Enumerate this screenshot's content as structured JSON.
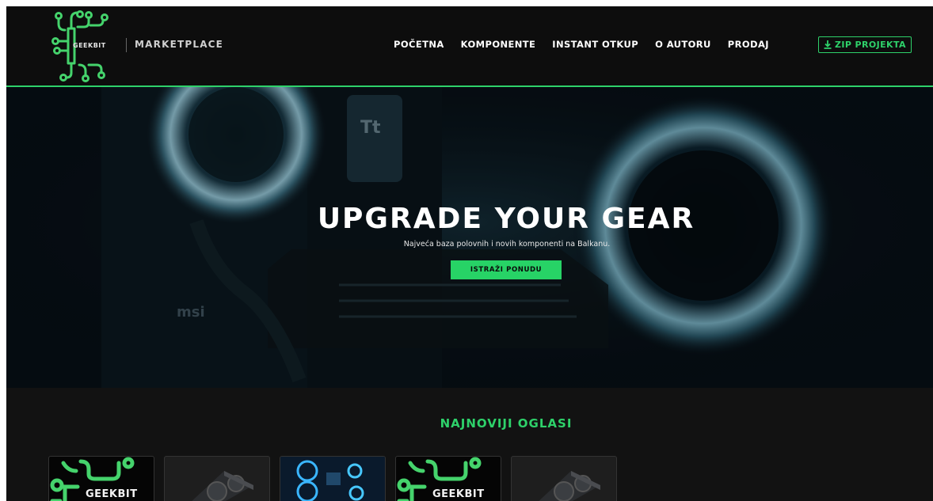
{
  "nav": {
    "brand": "GEEKBIT",
    "marketplace": "MARKETPLACE",
    "items": [
      {
        "label": "POČETNA"
      },
      {
        "label": "KOMPONENTE"
      },
      {
        "label": "INSTANT OTKUP"
      },
      {
        "label": "O AUTORU"
      },
      {
        "label": "PRODAJ"
      }
    ],
    "zip_label": "ZIP PROJEKTA"
  },
  "hero": {
    "title": "UPGRADE YOUR GEAR",
    "subtitle": "Najveća baza polovnih i novih komponenti na Balkanu.",
    "cta": "ISTRAŽI PONUDU"
  },
  "listings": {
    "title": "NAJNOVIJI OGLASI",
    "cards": [
      {
        "kind": "logo",
        "brand": "GEEKBIT"
      },
      {
        "kind": "gpu"
      },
      {
        "kind": "pc-case"
      },
      {
        "kind": "logo",
        "brand": "GEEKBIT"
      },
      {
        "kind": "gpu"
      }
    ]
  },
  "colors": {
    "accent": "#2ed16a",
    "background": "#111111",
    "nav_background": "#0d0d0d"
  },
  "icons": {
    "logo": "circuit-logo-icon",
    "zip": "download-icon"
  }
}
